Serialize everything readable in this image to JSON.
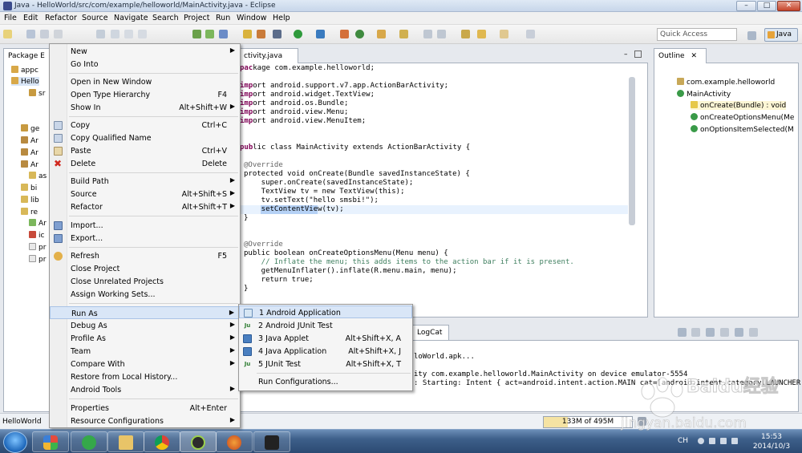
{
  "window": {
    "title": "Java - HelloWorld/src/com/example/helloworld/MainActivity.java - Eclipse",
    "min_label": "–",
    "max_label": "□",
    "close_label": "✕"
  },
  "menubar": [
    "File",
    "Edit",
    "Refactor",
    "Source",
    "Navigate",
    "Search",
    "Project",
    "Run",
    "Window",
    "Help"
  ],
  "toolbar": {
    "quick_access_placeholder": "Quick Access",
    "perspective_label": "Java"
  },
  "package_explorer": {
    "tab_label": "Package E",
    "rows": [
      "appc",
      "Hello",
      "sr",
      "ge",
      "Ar",
      "Ar",
      "Ar",
      "as",
      "bi",
      "lib",
      "re",
      "Ar",
      "ic",
      "pr",
      "pr"
    ]
  },
  "editor": {
    "tab_label": "ctivity.java",
    "lines": [
      "kage com.example.helloworld;",
      "",
      "ort android.support.v7.app.ActionBarActivity;",
      "ort android.widget.TextView;",
      "ort android.os.Bundle;",
      "ort android.view.Menu;",
      "ort android.view.MenuItem;",
      "",
      "lic class MainActivity extends ActionBarActivity {",
      "",
      "@Override",
      "protected void onCreate(Bundle savedInstanceState) {",
      "    super.onCreate(savedInstanceState);",
      "    TextView tv = new TextView(this);",
      "    tv.setText(\"hello smsbi!\");",
      "    setContentView(tv);",
      "}",
      "",
      "",
      "@Override",
      "public boolean onCreateOptionsMenu(Menu menu) {",
      "    // Inflate the menu; this adds items to the action bar if it is present.",
      "    getMenuInflater().inflate(R.menu.main, menu);",
      "    return true;",
      "}"
    ]
  },
  "outline": {
    "tab_label": "Outline",
    "rows": [
      "com.example.helloworld",
      "MainActivity",
      "onCreate(Bundle) : void",
      "onCreateOptionsMenu(Me",
      "onOptionsItemSelected(M"
    ]
  },
  "console": {
    "tab_label": "LogCat",
    "lines": [
      "loWorld.apk...",
      "",
      "ity com.example.helloworld.MainActivity on device emulator-5554",
      ": Starting: Intent { act=android.intent.action.MAIN cat=[android.intent.category.LAUNCHER"
    ]
  },
  "context_menu": {
    "items": [
      {
        "label": "New",
        "shortcut": "",
        "submenu": true
      },
      {
        "label": "Go Into",
        "shortcut": "",
        "submenu": false
      },
      {
        "label": "Open in New Window",
        "shortcut": "",
        "submenu": false
      },
      {
        "label": "Open Type Hierarchy",
        "shortcut": "F4",
        "submenu": false
      },
      {
        "label": "Show In",
        "shortcut": "Alt+Shift+W",
        "submenu": true
      },
      {
        "label": "Copy",
        "shortcut": "Ctrl+C",
        "submenu": false
      },
      {
        "label": "Copy Qualified Name",
        "shortcut": "",
        "submenu": false
      },
      {
        "label": "Paste",
        "shortcut": "Ctrl+V",
        "submenu": false
      },
      {
        "label": "Delete",
        "shortcut": "Delete",
        "submenu": false
      },
      {
        "label": "Build Path",
        "shortcut": "",
        "submenu": true
      },
      {
        "label": "Source",
        "shortcut": "Alt+Shift+S",
        "submenu": true
      },
      {
        "label": "Refactor",
        "shortcut": "Alt+Shift+T",
        "submenu": true
      },
      {
        "label": "Import...",
        "shortcut": "",
        "submenu": false
      },
      {
        "label": "Export...",
        "shortcut": "",
        "submenu": false
      },
      {
        "label": "Refresh",
        "shortcut": "F5",
        "submenu": false
      },
      {
        "label": "Close Project",
        "shortcut": "",
        "submenu": false
      },
      {
        "label": "Close Unrelated Projects",
        "shortcut": "",
        "submenu": false
      },
      {
        "label": "Assign Working Sets...",
        "shortcut": "",
        "submenu": false
      },
      {
        "label": "Run As",
        "shortcut": "",
        "submenu": true
      },
      {
        "label": "Debug As",
        "shortcut": "",
        "submenu": true
      },
      {
        "label": "Profile As",
        "shortcut": "",
        "submenu": true
      },
      {
        "label": "Team",
        "shortcut": "",
        "submenu": true
      },
      {
        "label": "Compare With",
        "shortcut": "",
        "submenu": true
      },
      {
        "label": "Restore from Local History...",
        "shortcut": "",
        "submenu": false
      },
      {
        "label": "Android Tools",
        "shortcut": "",
        "submenu": true
      },
      {
        "label": "Properties",
        "shortcut": "Alt+Enter",
        "submenu": false
      },
      {
        "label": "Resource Configurations",
        "shortcut": "",
        "submenu": true
      }
    ]
  },
  "run_as_submenu": {
    "items": [
      {
        "label": "1 Android Application",
        "shortcut": "",
        "icon_text": ""
      },
      {
        "label": "2 Android JUnit Test",
        "shortcut": "",
        "icon_text": "Ju"
      },
      {
        "label": "3 Java Applet",
        "shortcut": "Alt+Shift+X, A",
        "icon_text": ""
      },
      {
        "label": "4 Java Application",
        "shortcut": "Alt+Shift+X, J",
        "icon_text": ""
      },
      {
        "label": "5 JUnit Test",
        "shortcut": "Alt+Shift+X, T",
        "icon_text": "Ju"
      },
      {
        "label": "Run Configurations...",
        "shortcut": "",
        "icon_text": ""
      }
    ]
  },
  "status": {
    "left_text": "HelloWorld",
    "heap_text": "133M of 495M",
    "heap_used_fraction": 0.27
  },
  "taskbar": {
    "lang": "CH",
    "time": "15:53",
    "date": "2014/10/3"
  },
  "watermark": {
    "brand": "Baidu经验",
    "url": "jingyan.baidu.com"
  },
  "colors": {
    "accent": "#3875d7",
    "menu_highlight": "#d9e6f7"
  }
}
